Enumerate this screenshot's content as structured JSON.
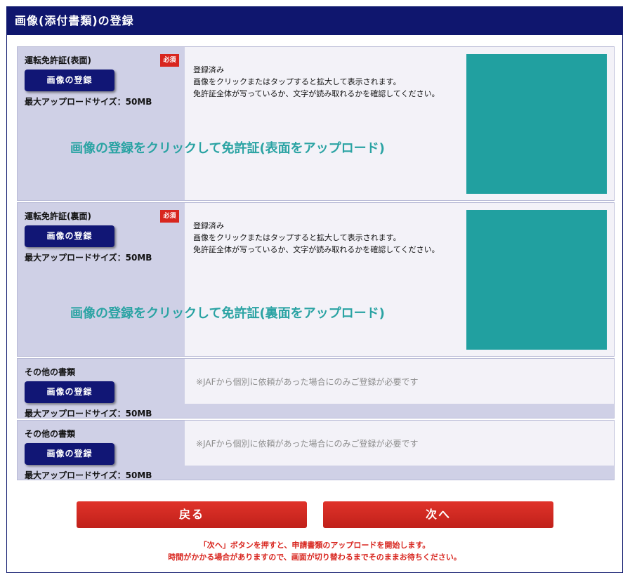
{
  "header": {
    "title": "画像(添付書類)の登録"
  },
  "documents": [
    {
      "label": "運転免許証(表面)",
      "required": "必須",
      "upload_button": "画像の登録",
      "max_size": "最大アップロードサイズ：50MB",
      "status_lines": [
        "登録済み",
        "画像をクリックまたはタップすると拡大して表示されます。",
        "免許証全体が写っているか、文字が読み取れるかを確認してください。"
      ],
      "thumbnail_color": "#21a0a0",
      "overlay_text": "画像の登録をクリックして免許証(表面をアップロード)"
    },
    {
      "label": "運転免許証(裏面)",
      "required": "必須",
      "upload_button": "画像の登録",
      "max_size": "最大アップロードサイズ：50MB",
      "status_lines": [
        "登録済み",
        "画像をクリックまたはタップすると拡大して表示されます。",
        "免許証全体が写っているか、文字が読み取れるかを確認してください。"
      ],
      "thumbnail_color": "#21a0a0",
      "overlay_text": "画像の登録をクリックして免許証(裏面をアップロード)"
    },
    {
      "label": "その他の書類",
      "upload_button": "画像の登録",
      "max_size": "最大アップロードサイズ：50MB",
      "note": "※JAFから個別に依頼があった場合にのみご登録が必要です"
    },
    {
      "label": "その他の書類",
      "upload_button": "画像の登録",
      "max_size": "最大アップロードサイズ：50MB",
      "note": "※JAFから個別に依頼があった場合にのみご登録が必要です"
    }
  ],
  "actions": {
    "back": "戻る",
    "next": "次へ"
  },
  "notice": [
    "「次へ」ボタンを押すと、申請書類のアップロードを開始します。",
    "時間がかかる場合がありますので、画面が切り替わるまでそのままお待ちください。"
  ],
  "colors": {
    "header": "#0f166e",
    "accent_red": "#d8261f",
    "teal": "#21a0a0"
  }
}
